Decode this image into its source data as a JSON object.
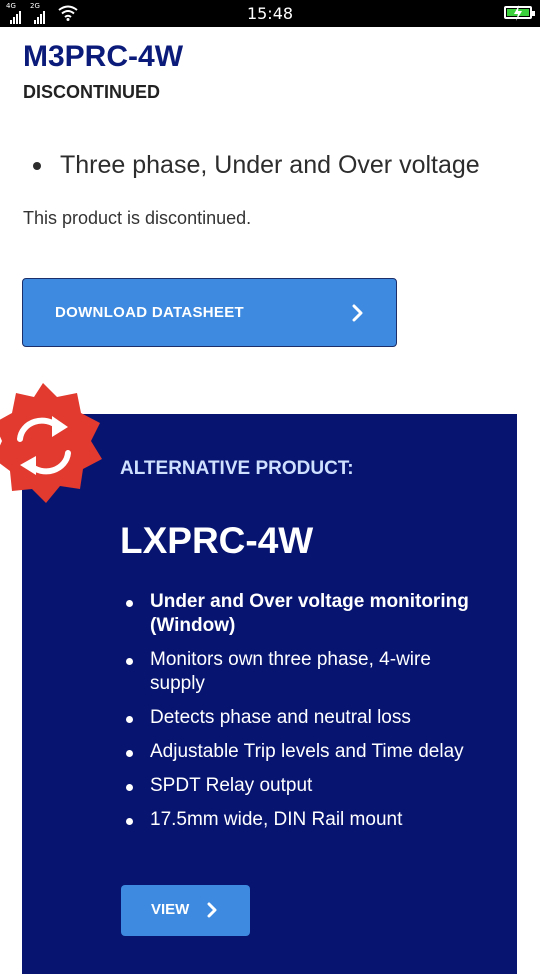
{
  "status_bar": {
    "time": "15:48",
    "network_1": "4G",
    "network_2": "2G",
    "icons": [
      "signal-icon",
      "signal-icon",
      "wifi-icon",
      "battery-charging-icon"
    ]
  },
  "product": {
    "code": "M3PRC-4W",
    "status": "DISCONTINUED",
    "features": [
      "Three phase, Under and Over voltage"
    ],
    "notice": "This product is discontinued."
  },
  "download": {
    "label": "DOWNLOAD DATASHEET",
    "icon": "chevron-right-icon"
  },
  "alternative": {
    "badge_icon": "refresh-icon",
    "heading": "ALTERNATIVE PRODUCT:",
    "code": "LXPRC-4W",
    "features": [
      "Under and Over voltage monitoring (Window)",
      "Monitors own three phase, 4-wire supply",
      "Detects phase and neutral loss",
      "Adjustable Trip levels and Time delay",
      "SPDT Relay output",
      "17.5mm wide, DIN Rail mount"
    ],
    "view_label": "VIEW"
  },
  "colors": {
    "brand_navy": "#071570",
    "title_navy": "#0b1b7a",
    "button_blue": "#3d8ae0",
    "badge_red": "#e23a2e"
  }
}
